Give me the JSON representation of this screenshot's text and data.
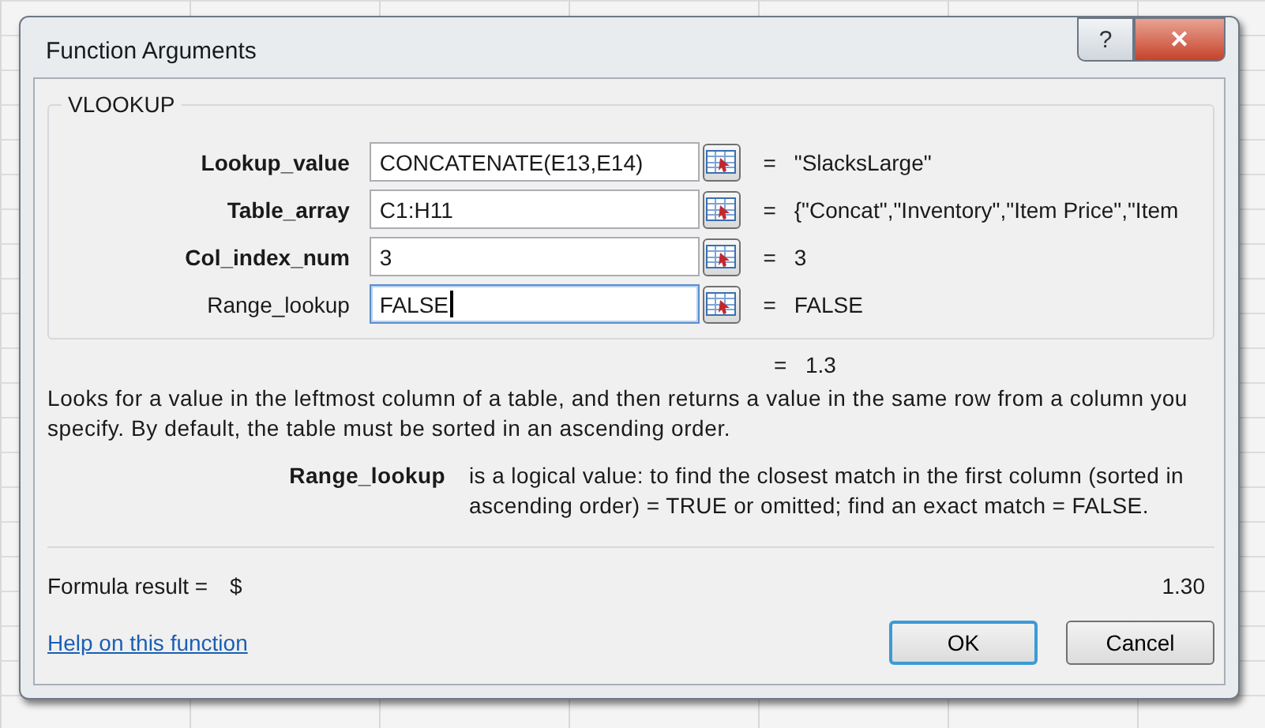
{
  "window": {
    "title": "Function Arguments"
  },
  "title_buttons": [
    {
      "kind": "help",
      "label": "?"
    },
    {
      "kind": "close",
      "label": "✕"
    }
  ],
  "group": {
    "title": "VLOOKUP",
    "arguments": [
      {
        "label": "Lookup_value",
        "required": true,
        "value": "CONCATENATE(E13,E14)",
        "focused": false,
        "result": "\"SlacksLarge\""
      },
      {
        "label": "Table_array",
        "required": true,
        "value": "C1:H11",
        "focused": false,
        "result": "{\"Concat\",\"Inventory\",\"Item Price\",\"Item"
      },
      {
        "label": "Col_index_num",
        "required": true,
        "value": "3",
        "focused": false,
        "result": "3"
      },
      {
        "label": "Range_lookup",
        "required": false,
        "value": "FALSE",
        "focused": true,
        "result": "FALSE"
      }
    ]
  },
  "result_sign": "=",
  "function_result": "1.3",
  "description": "Looks for a value in the leftmost column of a table, and then returns a value in the same row from a column you specify. By default, the table must be sorted in an ascending order.",
  "argument_help": {
    "name": "Range_lookup",
    "text": "is a logical value: to find the closest match in the first column (sorted in ascending order) = TRUE or omitted; find an exact match = FALSE."
  },
  "formula_result": {
    "label": "Formula result =",
    "currency": "$",
    "value": "1.30"
  },
  "help_link": "Help on this function",
  "buttons": [
    {
      "label": "OK",
      "default": true
    },
    {
      "label": "Cancel",
      "default": false
    }
  ]
}
